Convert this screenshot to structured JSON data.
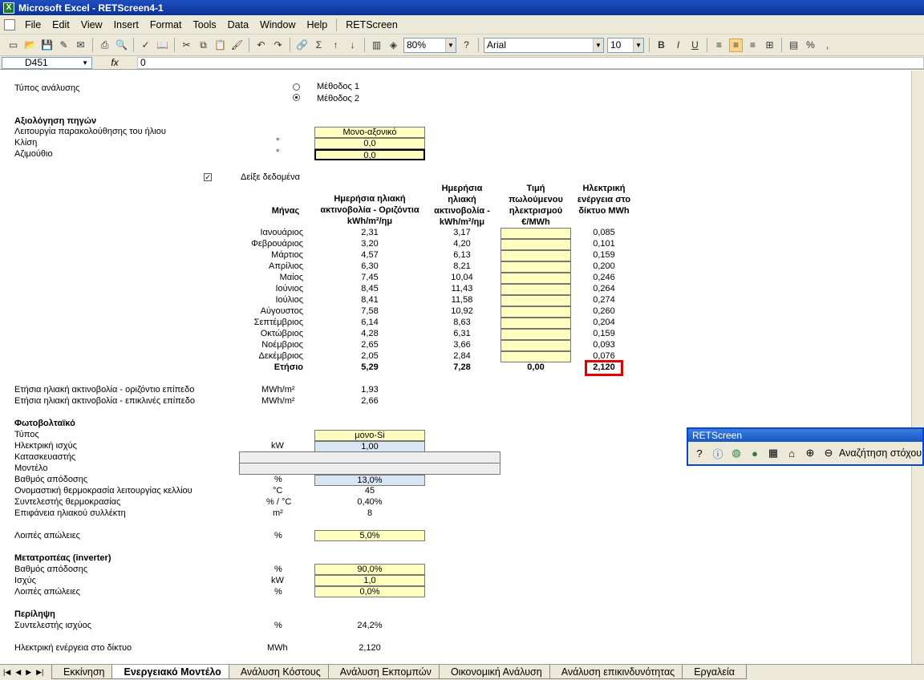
{
  "window": {
    "title": "Microsoft Excel - RETScreen4-1"
  },
  "menu": [
    "File",
    "Edit",
    "View",
    "Insert",
    "Format",
    "Tools",
    "Data",
    "Window",
    "Help",
    "RETScreen"
  ],
  "toolbar": {
    "zoom": "80%",
    "font": "Arial",
    "font_size": "10"
  },
  "formula_bar": {
    "cell_ref": "D451",
    "fx": "fx",
    "value": "0"
  },
  "analysis": {
    "label": "Τύπος ανάλυσης",
    "method1": "Μέθοδος 1",
    "method2": "Μέθοδος 2"
  },
  "resource": {
    "title": "Αξιολόγηση πηγών",
    "tracking_label": "Λειτουργία παρακολούθησης του ήλιου",
    "tracking_value": "Μονο-αξονικό",
    "slope_label": "Κλίση",
    "slope_unit": "°",
    "slope_value": "0,0",
    "azimuth_label": "Αζιμούθιο",
    "azimuth_unit": "°",
    "azimuth_value": "0,0",
    "show_data": "Δείξε δεδομένα"
  },
  "table": {
    "headers": {
      "month": "Μήνας",
      "horizontal": "Ημερήσια ηλιακή ακτινοβολία - Οριζόντια kWh/m²/ημ",
      "tilted": "Ημερήσια ηλιακή ακτινοβολία - kWh/m²/ημ",
      "price": "Τιμή πωλούμενου ηλεκτρισμού €/MWh",
      "energy": "Ηλεκτρική ενέργεια στο δίκτυο MWh"
    },
    "rows": [
      {
        "month": "Ιανουάριος",
        "h": "2,31",
        "t": "3,17",
        "e": "0,085"
      },
      {
        "month": "Φεβρουάριος",
        "h": "3,20",
        "t": "4,20",
        "e": "0,101"
      },
      {
        "month": "Μάρτιος",
        "h": "4,57",
        "t": "6,13",
        "e": "0,159"
      },
      {
        "month": "Απρίλιος",
        "h": "6,30",
        "t": "8,21",
        "e": "0,200"
      },
      {
        "month": "Μαίος",
        "h": "7,45",
        "t": "10,04",
        "e": "0,246"
      },
      {
        "month": "Ιούνιος",
        "h": "8,45",
        "t": "11,43",
        "e": "0,264"
      },
      {
        "month": "Ιούλιος",
        "h": "8,41",
        "t": "11,58",
        "e": "0,274"
      },
      {
        "month": "Αύγουστος",
        "h": "7,58",
        "t": "10,92",
        "e": "0,260"
      },
      {
        "month": "Σεπτέμβριος",
        "h": "6,14",
        "t": "8,63",
        "e": "0,204"
      },
      {
        "month": "Οκτώβριος",
        "h": "4,28",
        "t": "6,31",
        "e": "0,159"
      },
      {
        "month": "Νοέμβριος",
        "h": "2,65",
        "t": "3,66",
        "e": "0,093"
      },
      {
        "month": "Δεκέμβριος",
        "h": "2,05",
        "t": "2,84",
        "e": "0,076"
      }
    ],
    "annual": {
      "label": "Ετήσιο",
      "h": "5,29",
      "t": "7,28",
      "price": "0,00",
      "e": "2,120"
    }
  },
  "annual_rad": {
    "horizontal_label": "Ετήσια ηλιακή ακτινοβολία - οριζόντιο επίπεδο",
    "horizontal_unit": "MWh/m²",
    "horizontal_value": "1,93",
    "tilted_label": "Ετήσια ηλιακή ακτινοβολία - επικλινές επίπεδο",
    "tilted_unit": "MWh/m²",
    "tilted_value": "2,66"
  },
  "pv": {
    "title": "Φωτοβολταϊκό",
    "type_label": "Τύπος",
    "type_value": "μονο-Si",
    "power_label": "Ηλεκτρική ισχύς",
    "power_unit": "kW",
    "power_value": "1,00",
    "manufacturer_label": "Κατασκευαστής",
    "model_label": "Μοντέλο",
    "eff_label": "Βαθμός απόδοσης",
    "eff_unit": "%",
    "eff_value": "13,0%",
    "noct_label": "Ονομαστική θερμοκρασία λειτουργίας κελλίου",
    "noct_unit": "°C",
    "noct_value": "45",
    "tempcoef_label": "Συντελεστής θερμοκρασίας",
    "tempcoef_unit": "% / °C",
    "tempcoef_value": "0,40%",
    "area_label": "Επιφάνεια ηλιακού συλλέκτη",
    "area_unit": "m²",
    "area_value": "8",
    "losses_label": "Λοιπές απώλειες",
    "losses_unit": "%",
    "losses_value": "5,0%"
  },
  "inverter": {
    "title": "Μετατροπέας (inverter)",
    "eff_label": "Βαθμός απόδοσης",
    "eff_unit": "%",
    "eff_value": "90,0%",
    "cap_label": "Ισχύς",
    "cap_unit": "kW",
    "cap_value": "1,0",
    "losses_label": "Λοιπές απώλειες",
    "losses_unit": "%",
    "losses_value": "0,0%"
  },
  "summary": {
    "title": "Περίληψη",
    "cf_label": "Συντελεστής ισχύος",
    "cf_unit": "%",
    "cf_value": "24,2%",
    "energy_label": "Ηλεκτρική ενέργεια στο δίκτυο",
    "energy_unit": "MWh",
    "energy_value": "2,120"
  },
  "retscreen_toolbar": {
    "title": "RETScreen",
    "search": "Αναζήτηση στόχου"
  },
  "tabs": [
    "Εκκίνηση",
    "Ενεργειακό Μοντέλο",
    "Ανάλυση Κόστους",
    "Ανάλυση Εκπομπών",
    "Οικονομική Ανάλυση",
    "Ανάλυση επικινδυνότητας",
    "Εργαλεία"
  ]
}
